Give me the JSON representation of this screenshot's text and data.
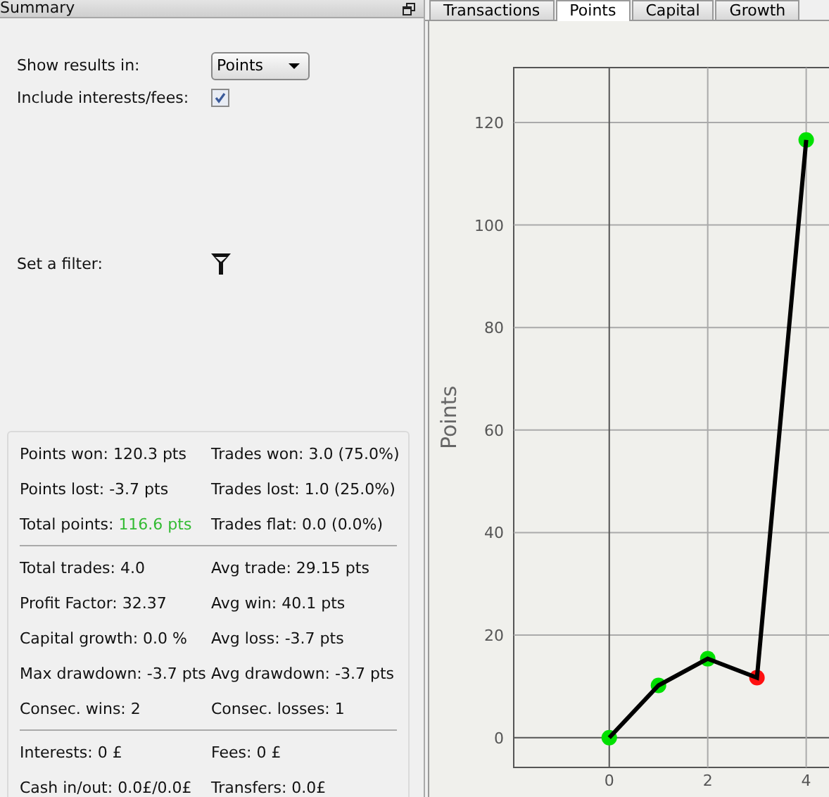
{
  "panel": {
    "title": "Summary"
  },
  "settings": {
    "results_label": "Show results in:",
    "results_value": "Points",
    "interests_label": "Include interests/fees:",
    "interests_checked": true,
    "filter_label": "Set a filter:"
  },
  "stats": [
    [
      {
        "label": "Points won:",
        "value": "120.3 pts",
        "highlight": false
      },
      {
        "label": "Trades won:",
        "value": "3.0 (75.0%)",
        "highlight": false
      },
      {
        "label": "Points lost:",
        "value": "-3.7 pts",
        "highlight": false
      },
      {
        "label": "Trades lost:",
        "value": "1.0 (25.0%)",
        "highlight": false
      },
      {
        "label": "Total points:",
        "value": "116.6 pts",
        "highlight": true
      },
      {
        "label": "Trades flat:",
        "value": "0.0 (0.0%)",
        "highlight": false
      }
    ],
    [
      {
        "label": "Total trades:",
        "value": "4.0",
        "highlight": false
      },
      {
        "label": "Avg trade:",
        "value": "29.15 pts",
        "highlight": false
      },
      {
        "label": "Profit Factor:",
        "value": "32.37",
        "highlight": false
      },
      {
        "label": "Avg win:",
        "value": "40.1 pts",
        "highlight": false
      },
      {
        "label": "Capital growth:",
        "value": "0.0 %",
        "highlight": false
      },
      {
        "label": "Avg loss:",
        "value": "-3.7 pts",
        "highlight": false
      },
      {
        "label": "Max drawdown:",
        "value": "-3.7 pts",
        "highlight": false
      },
      {
        "label": "Avg drawdown:",
        "value": "-3.7 pts",
        "highlight": false
      },
      {
        "label": "Consec. wins:",
        "value": "2",
        "highlight": false
      },
      {
        "label": "Consec. losses:",
        "value": "1",
        "highlight": false
      }
    ],
    [
      {
        "label": "Interests:",
        "value": "0 £",
        "highlight": false
      },
      {
        "label": "Fees:",
        "value": "0 £",
        "highlight": false
      },
      {
        "label": "Cash in/out:",
        "value": "0.0£/0.0£",
        "highlight": false
      },
      {
        "label": "Transfers:",
        "value": "0.0£",
        "highlight": false
      }
    ]
  ],
  "tabs": [
    {
      "label": "Transactions",
      "selected": false
    },
    {
      "label": "Points",
      "selected": true
    },
    {
      "label": "Capital",
      "selected": false
    },
    {
      "label": "Growth",
      "selected": false
    }
  ],
  "chart": {
    "markers": [
      {
        "color": "#00e000"
      },
      {
        "color": "#00e000"
      },
      {
        "color": "#00e000"
      },
      {
        "color": "#ff1010"
      },
      {
        "color": "#00e000"
      }
    ],
    "chart_data": {
      "type": "line",
      "ylabel": "Points",
      "x": [
        0,
        1,
        2,
        3,
        4
      ],
      "grid": true,
      "series": [
        {
          "color": "#000000",
          "values": [
            0,
            10.2,
            15.4,
            11.7,
            116.6
          ],
          "marker": "circle"
        }
      ],
      "xlim": [
        -1.94,
        4.52
      ],
      "ylim": [
        -5.8,
        130.7
      ],
      "xticks": [
        0,
        2,
        4
      ],
      "yticks": [
        0,
        20,
        40,
        60,
        80,
        100,
        120
      ]
    }
  }
}
